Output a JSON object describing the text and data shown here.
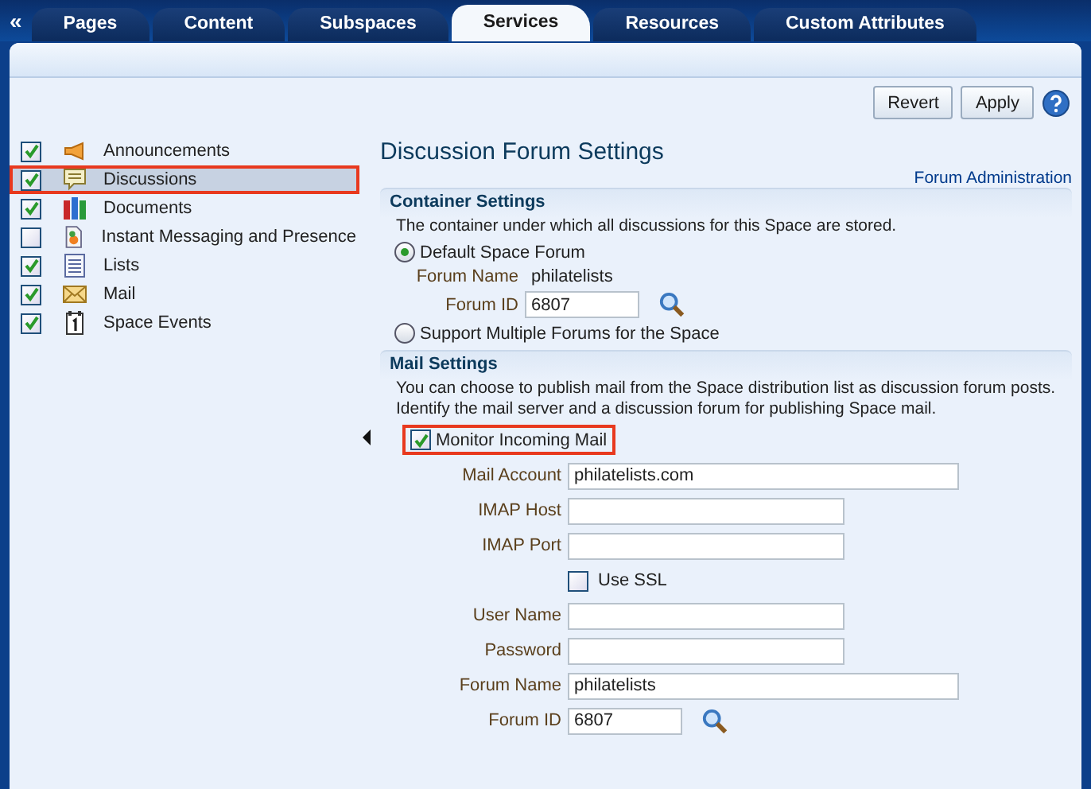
{
  "tabs": [
    {
      "label": "Pages",
      "selected": false
    },
    {
      "label": "Content",
      "selected": false
    },
    {
      "label": "Subspaces",
      "selected": false
    },
    {
      "label": "Services",
      "selected": true
    },
    {
      "label": "Resources",
      "selected": false
    },
    {
      "label": "Custom Attributes",
      "selected": false
    }
  ],
  "collapse_glyph": "«",
  "toolbar": {
    "buttons": [
      "Revert",
      "Apply"
    ]
  },
  "services": [
    {
      "label": "Announcements",
      "kind": "megaphone",
      "checked": true,
      "selected": false
    },
    {
      "label": "Discussions",
      "kind": "speech-bubble",
      "checked": true,
      "selected": true
    },
    {
      "label": "Documents",
      "kind": "books",
      "checked": true,
      "selected": false
    },
    {
      "label": "Instant Messaging and Presence",
      "kind": "document",
      "checked": false,
      "selected": false
    },
    {
      "label": "Lists",
      "kind": "list",
      "checked": true,
      "selected": false
    },
    {
      "label": "Mail",
      "kind": "envelope",
      "checked": true,
      "selected": false
    },
    {
      "label": "Space Events",
      "kind": "calendar",
      "checked": true,
      "selected": false
    }
  ],
  "settings": {
    "title": "Discussion Forum Settings",
    "link": "Forum Administration",
    "container": {
      "heading": "Container Settings",
      "description": "The container under which all discussions for this Space are stored.",
      "options": [
        {
          "label": "Default Space Forum",
          "selected": true
        },
        {
          "label": "Support Multiple Forums for the Space",
          "selected": false
        }
      ],
      "forum_name": {
        "label": "Forum Name",
        "value": "philatelists"
      },
      "forum_id": {
        "label": "Forum ID",
        "value": "6807"
      }
    },
    "mail": {
      "heading": "Mail Settings",
      "description": "You can choose to publish mail from the Space distribution list as discussion forum posts. Identify the mail server and a discussion forum for publishing Space mail.",
      "monitor": {
        "label": "Monitor Incoming Mail",
        "checked": true,
        "highlighted": true
      },
      "fields": [
        {
          "kind": "text",
          "label": "Mail Account",
          "value": "philatelists.com"
        },
        {
          "kind": "text",
          "label": "IMAP Host"
        },
        {
          "kind": "text",
          "label": "IMAP Port"
        },
        {
          "kind": "checkbox",
          "label": "Use SSL",
          "checked": false
        },
        {
          "kind": "text",
          "label": "User Name"
        },
        {
          "kind": "text",
          "label": "Password"
        },
        {
          "kind": "text",
          "label": "Forum Name",
          "value": "philatelists"
        },
        {
          "kind": "lookup",
          "label": "Forum ID",
          "value": "6807"
        }
      ]
    }
  }
}
